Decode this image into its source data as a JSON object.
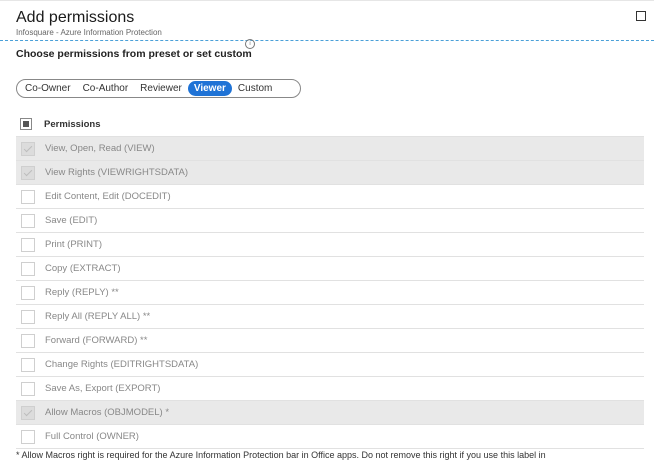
{
  "header": {
    "title": "Add permissions",
    "subtitle": "Infosquare - Azure Information Protection"
  },
  "instruction": "Choose permissions from preset or set custom",
  "presets": {
    "options": [
      "Co-Owner",
      "Co-Author",
      "Reviewer",
      "Viewer",
      "Custom"
    ],
    "selected": "Viewer"
  },
  "permissions": {
    "header_label": "Permissions",
    "rows": [
      {
        "label": "View, Open, Read (VIEW)",
        "checked": true
      },
      {
        "label": "View Rights (VIEWRIGHTSDATA)",
        "checked": true
      },
      {
        "label": "Edit Content, Edit (DOCEDIT)",
        "checked": false
      },
      {
        "label": "Save (EDIT)",
        "checked": false
      },
      {
        "label": "Print (PRINT)",
        "checked": false
      },
      {
        "label": "Copy (EXTRACT)",
        "checked": false
      },
      {
        "label": "Reply (REPLY) **",
        "checked": false
      },
      {
        "label": "Reply All (REPLY ALL) **",
        "checked": false
      },
      {
        "label": "Forward (FORWARD) **",
        "checked": false
      },
      {
        "label": "Change Rights (EDITRIGHTSDATA)",
        "checked": false
      },
      {
        "label": "Save As, Export (EXPORT)",
        "checked": false
      },
      {
        "label": "Allow Macros (OBJMODEL) *",
        "checked": true
      },
      {
        "label": "Full Control (OWNER)",
        "checked": false
      }
    ]
  },
  "footnote": "* Allow Macros right is required for the Azure Information Protection bar in Office apps. Do not remove this right if you use this label in",
  "colors": {
    "accent": "#1f73d6",
    "divider": "#4aa0d8",
    "row_checked_bg": "#e9e9e9"
  }
}
